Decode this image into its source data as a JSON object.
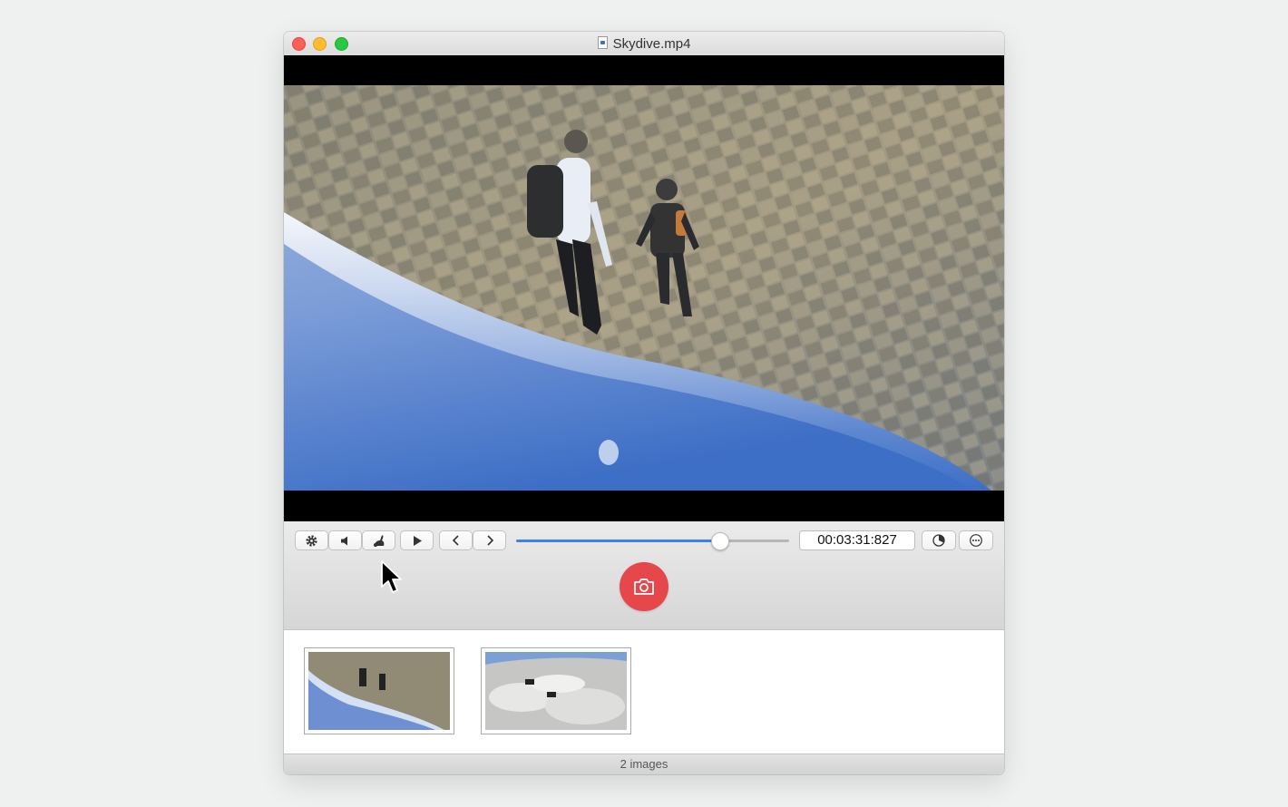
{
  "window": {
    "title": "Skydive.mp4"
  },
  "video": {
    "file_icon": "quicktime-doc-icon",
    "scene": "skydive-photo"
  },
  "toolbar": {
    "buttons": [
      {
        "name": "settings",
        "icon": "gear-icon"
      },
      {
        "name": "volume",
        "icon": "speaker-icon"
      },
      {
        "name": "speed",
        "icon": "rabbit-icon"
      },
      {
        "name": "play",
        "icon": "play-icon"
      },
      {
        "name": "previous-frame",
        "icon": "chevron-left-icon"
      },
      {
        "name": "next-frame",
        "icon": "chevron-right-icon"
      },
      {
        "name": "timer",
        "icon": "timer-icon"
      },
      {
        "name": "more",
        "icon": "ellipsis-icon"
      }
    ],
    "progress": 0.745,
    "timecode": "00:03:31:827",
    "accent_color": "#3b82f0"
  },
  "capture": {
    "icon": "camera-icon",
    "color": "#e5474b"
  },
  "thumbnails": [
    {
      "name": "capture-1"
    },
    {
      "name": "capture-2"
    }
  ],
  "status": {
    "count_label": "2 images"
  }
}
